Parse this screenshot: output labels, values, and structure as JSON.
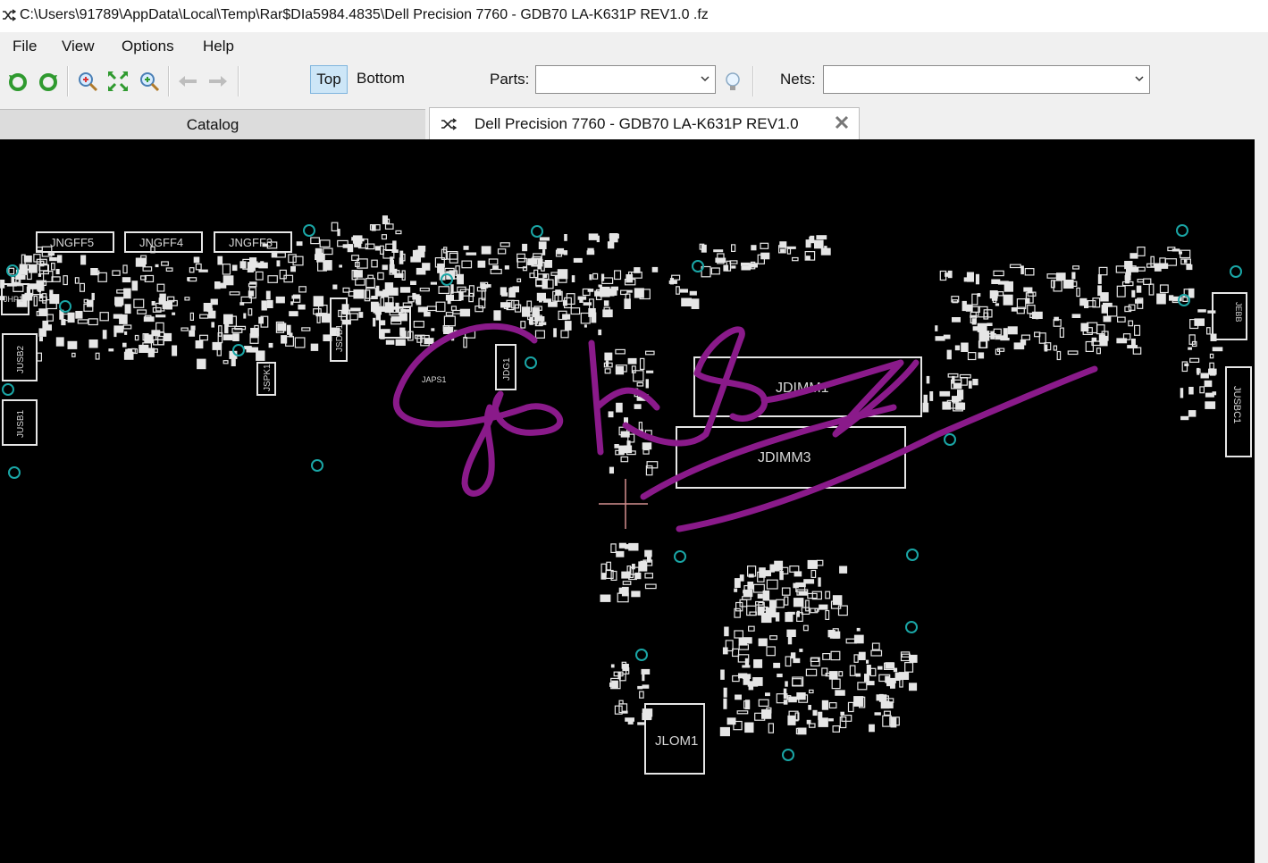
{
  "window": {
    "title": "C:\\Users\\91789\\AppData\\Local\\Temp\\Rar$DIa5984.4835\\Dell Precision 7760 - GDB70 LA-K631P REV1.0 .fz"
  },
  "menu": {
    "items": [
      "File",
      "View",
      "Options",
      "Help"
    ]
  },
  "toolbar": {
    "top_label": "Top",
    "bottom_label": "Bottom",
    "parts_label": "Parts:",
    "parts_value": "",
    "nets_label": "Nets:",
    "nets_value": "",
    "icons": [
      "rotate-left-icon",
      "rotate-right-icon",
      "zoom-in-icon",
      "fit-screen-icon",
      "zoom-out-icon",
      "back-arrow-icon",
      "forward-arrow-icon",
      "highlight-bulb-icon"
    ]
  },
  "tabs": {
    "catalog_label": "Catalog",
    "document_label": "Dell Precision 7760 - GDB70 LA-K631P REV1.0"
  },
  "board": {
    "labels": {
      "jngff5": "JNGFF5",
      "jngff4": "JNGFF4",
      "jngff3": "JNGFF3",
      "jhp1": "JHP1",
      "jusb2": "JUSB2",
      "jusb1": "JUSB1",
      "jsdb1": "JSDB1",
      "jspk1": "JSPK1",
      "jdg1": "JDG1",
      "japs1": "JAPS1",
      "jdimm1": "JDIMM1",
      "jdimm3": "JDIMM3",
      "jlom1": "JLOM1",
      "jusbc1": "JUSBC1",
      "jebb": "JEBB"
    },
    "colors": {
      "background": "#000000",
      "components": "#e6e6e6",
      "vias": "#1aa6a6",
      "annotation": "#8a1a8a"
    }
  }
}
